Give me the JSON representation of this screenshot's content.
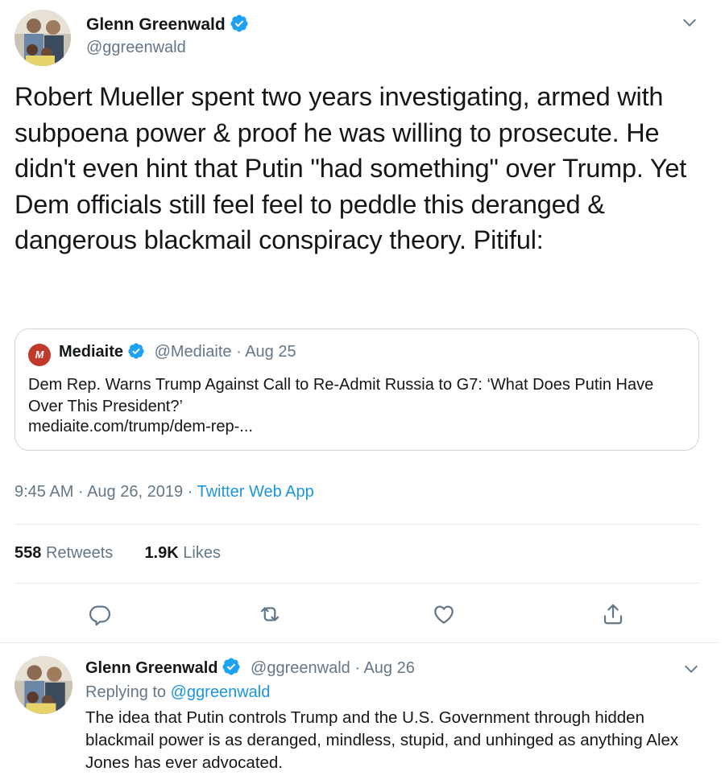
{
  "main_tweet": {
    "author_name": "Glenn Greenwald",
    "author_handle": "@ggreenwald",
    "text": "Robert Mueller spent two years investigating, armed with subpoena power & proof he was willing to prosecute. He didn't even hint that Putin \"had something\" over Trump. Yet Dem officials still feel feel to peddle this deranged & dangerous blackmail conspiracy theory. Pitiful:",
    "quoted": {
      "logo_letter": "M",
      "name": "Mediaite",
      "handle": "@Mediaite",
      "date": "Aug 25",
      "title": "Dem Rep. Warns Trump Against Call to Re-Admit Russia to G7: ‘What Does Putin Have Over This President?’",
      "link": "mediaite.com/trump/dem-rep-..."
    },
    "time": "9:45 AM",
    "date": "Aug 26, 2019",
    "source": "Twitter Web App",
    "retweets_count": "558",
    "retweets_label": "Retweets",
    "likes_count": "1.9K",
    "likes_label": "Likes"
  },
  "reply_tweet": {
    "author_name": "Glenn Greenwald",
    "author_handle": "@ggreenwald",
    "date": "Aug 26",
    "replying_label": "Replying to",
    "replying_handle": "@ggreenwald",
    "text": "The idea that Putin controls Trump and the U.S. Government through hidden blackmail power is as deranged, mindless, stupid, and unhinged as anything Alex Jones has ever advocated."
  },
  "colors": {
    "verified": "#1da1f2",
    "link": "#1b95e0",
    "muted": "#657786",
    "border": "#e6ecf0"
  },
  "icons": [
    "verified-badge-icon",
    "chevron-down-icon",
    "reply-icon",
    "retweet-icon",
    "like-icon",
    "share-icon"
  ]
}
